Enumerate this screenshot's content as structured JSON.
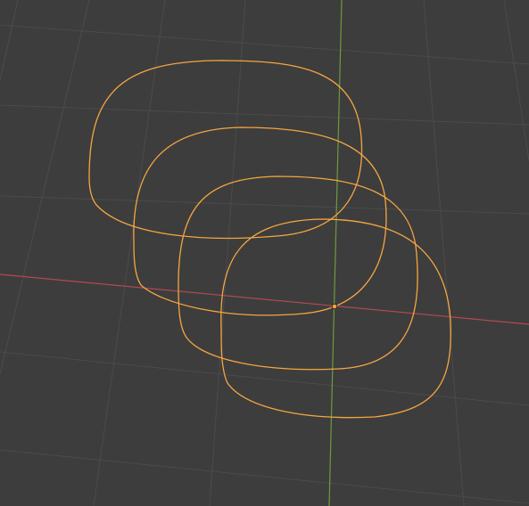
{
  "viewport": {
    "view": "3d-viewport",
    "background_color": "#3d3d3d",
    "grid_color": "#4b4b4b",
    "x_axis_color": "#b24a52",
    "y_axis_color": "#6f9a3c",
    "selection_color": "#f5a640",
    "selected_object": {
      "type": "curve",
      "loop_count": 4,
      "origin_visible": true
    }
  }
}
